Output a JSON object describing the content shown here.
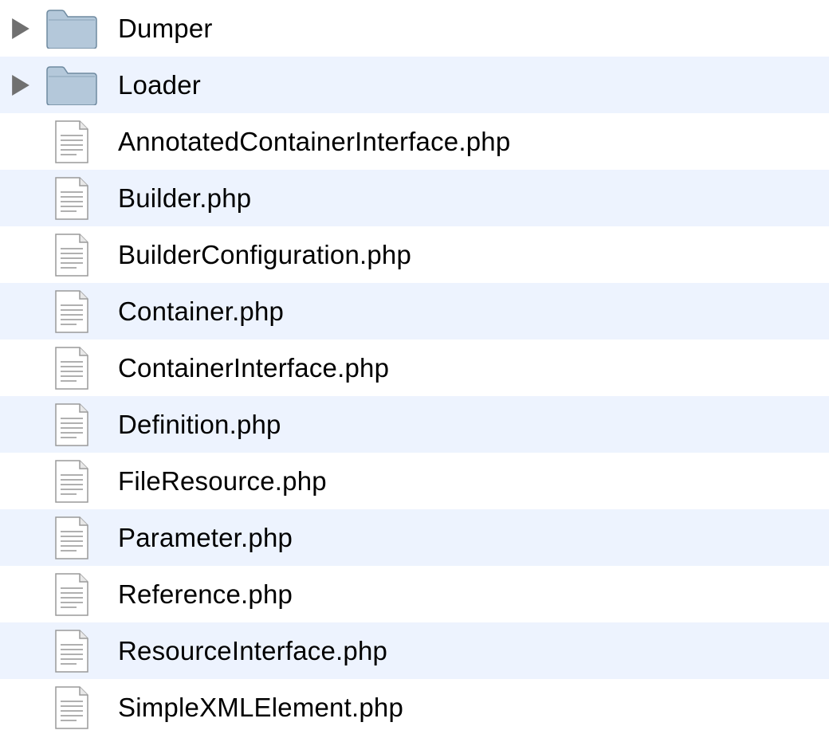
{
  "tree": {
    "items": [
      {
        "type": "folder",
        "expanded": false,
        "label": "Dumper"
      },
      {
        "type": "folder",
        "expanded": false,
        "label": "Loader"
      },
      {
        "type": "file",
        "label": "AnnotatedContainerInterface.php"
      },
      {
        "type": "file",
        "label": "Builder.php"
      },
      {
        "type": "file",
        "label": "BuilderConfiguration.php"
      },
      {
        "type": "file",
        "label": "Container.php"
      },
      {
        "type": "file",
        "label": "ContainerInterface.php"
      },
      {
        "type": "file",
        "label": "Definition.php"
      },
      {
        "type": "file",
        "label": "FileResource.php"
      },
      {
        "type": "file",
        "label": "Parameter.php"
      },
      {
        "type": "file",
        "label": "Reference.php"
      },
      {
        "type": "file",
        "label": "ResourceInterface.php"
      },
      {
        "type": "file",
        "label": "SimpleXMLElement.php"
      }
    ]
  }
}
